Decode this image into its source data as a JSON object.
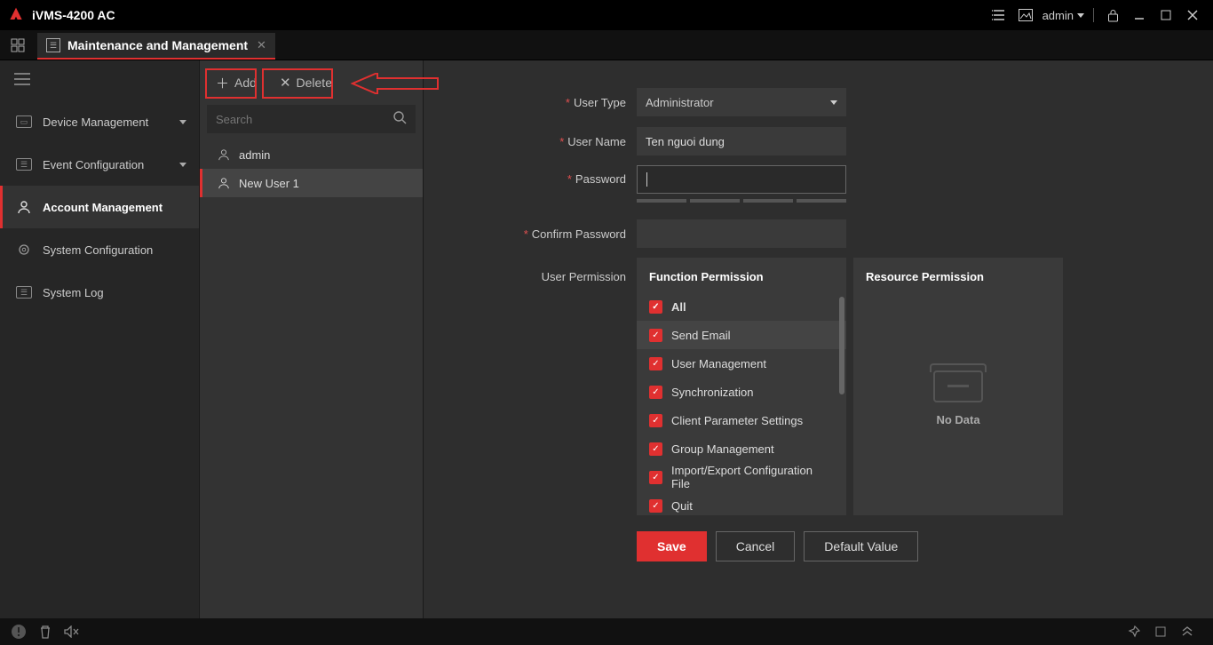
{
  "app": {
    "title": "iVMS-4200 AC",
    "user": "admin"
  },
  "tab": {
    "title": "Maintenance and Management"
  },
  "nav": {
    "items": [
      {
        "label": "Device Management"
      },
      {
        "label": "Event Configuration"
      },
      {
        "label": "Account Management"
      },
      {
        "label": "System Configuration"
      },
      {
        "label": "System Log"
      }
    ]
  },
  "list": {
    "add": "Add",
    "delete": "Delete",
    "search_placeholder": "Search",
    "users": [
      {
        "name": "admin"
      },
      {
        "name": "New User 1"
      }
    ]
  },
  "form": {
    "labels": {
      "user_type": "User Type",
      "user_name": "User Name",
      "password": "Password",
      "confirm_password": "Confirm Password",
      "user_permission": "User Permission"
    },
    "user_type_value": "Administrator",
    "user_name_value": "Ten nguoi dung",
    "password_value": "",
    "confirm_password_value": "",
    "function_permission": {
      "header": "Function Permission",
      "items": [
        "All",
        "Send Email",
        "User Management",
        "Synchronization",
        "Client Parameter Settings",
        "Group Management",
        "Import/Export Configuration File",
        "Quit"
      ]
    },
    "resource_permission": {
      "header": "Resource Permission",
      "empty": "No Data"
    },
    "buttons": {
      "save": "Save",
      "cancel": "Cancel",
      "default": "Default Value"
    }
  }
}
